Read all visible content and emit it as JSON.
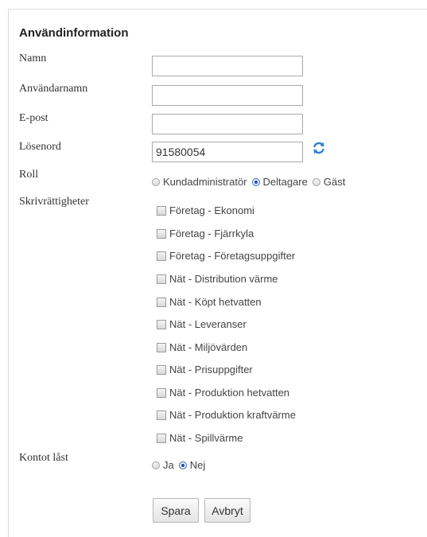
{
  "form": {
    "title": "Användinformation",
    "labels": {
      "name": "Namn",
      "username": "Användarnamn",
      "email": "E-post",
      "password": "Lösenord",
      "role": "Roll",
      "permissions": "Skrivrättigheter",
      "locked": "Kontot låst"
    },
    "values": {
      "name": "",
      "username": "",
      "email": "",
      "password": "91580054"
    },
    "role_options": [
      "Kundadministratör",
      "Deltagare",
      "Gäst"
    ],
    "role_selected": "Deltagare",
    "permissions": [
      "Företag - Ekonomi",
      "Företag - Fjärrkyla",
      "Företag - Företagsuppgifter",
      "Nät - Distribution värme",
      "Nät - Köpt hetvatten",
      "Nät - Leveranser",
      "Nät - Miljövärden",
      "Nät - Prisuppgifter",
      "Nät - Produktion hetvatten",
      "Nät - Produktion kraftvärme",
      "Nät - Spillvärme"
    ],
    "locked_options": [
      "Ja",
      "Nej"
    ],
    "locked_selected": "Nej",
    "buttons": {
      "save": "Spara",
      "cancel": "Avbryt"
    },
    "icons": {
      "refresh": "refresh-icon"
    }
  }
}
